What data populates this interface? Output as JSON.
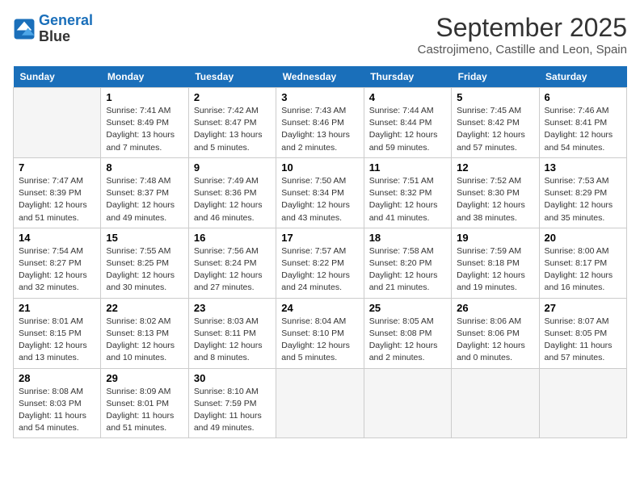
{
  "header": {
    "logo_line1": "General",
    "logo_line2": "Blue",
    "month": "September 2025",
    "location": "Castrojimeno, Castille and Leon, Spain"
  },
  "days_of_week": [
    "Sunday",
    "Monday",
    "Tuesday",
    "Wednesday",
    "Thursday",
    "Friday",
    "Saturday"
  ],
  "weeks": [
    [
      {
        "day": "",
        "empty": true
      },
      {
        "day": "1",
        "sunrise": "Sunrise: 7:41 AM",
        "sunset": "Sunset: 8:49 PM",
        "daylight": "Daylight: 13 hours and 7 minutes."
      },
      {
        "day": "2",
        "sunrise": "Sunrise: 7:42 AM",
        "sunset": "Sunset: 8:47 PM",
        "daylight": "Daylight: 13 hours and 5 minutes."
      },
      {
        "day": "3",
        "sunrise": "Sunrise: 7:43 AM",
        "sunset": "Sunset: 8:46 PM",
        "daylight": "Daylight: 13 hours and 2 minutes."
      },
      {
        "day": "4",
        "sunrise": "Sunrise: 7:44 AM",
        "sunset": "Sunset: 8:44 PM",
        "daylight": "Daylight: 12 hours and 59 minutes."
      },
      {
        "day": "5",
        "sunrise": "Sunrise: 7:45 AM",
        "sunset": "Sunset: 8:42 PM",
        "daylight": "Daylight: 12 hours and 57 minutes."
      },
      {
        "day": "6",
        "sunrise": "Sunrise: 7:46 AM",
        "sunset": "Sunset: 8:41 PM",
        "daylight": "Daylight: 12 hours and 54 minutes."
      }
    ],
    [
      {
        "day": "7",
        "sunrise": "Sunrise: 7:47 AM",
        "sunset": "Sunset: 8:39 PM",
        "daylight": "Daylight: 12 hours and 51 minutes."
      },
      {
        "day": "8",
        "sunrise": "Sunrise: 7:48 AM",
        "sunset": "Sunset: 8:37 PM",
        "daylight": "Daylight: 12 hours and 49 minutes."
      },
      {
        "day": "9",
        "sunrise": "Sunrise: 7:49 AM",
        "sunset": "Sunset: 8:36 PM",
        "daylight": "Daylight: 12 hours and 46 minutes."
      },
      {
        "day": "10",
        "sunrise": "Sunrise: 7:50 AM",
        "sunset": "Sunset: 8:34 PM",
        "daylight": "Daylight: 12 hours and 43 minutes."
      },
      {
        "day": "11",
        "sunrise": "Sunrise: 7:51 AM",
        "sunset": "Sunset: 8:32 PM",
        "daylight": "Daylight: 12 hours and 41 minutes."
      },
      {
        "day": "12",
        "sunrise": "Sunrise: 7:52 AM",
        "sunset": "Sunset: 8:30 PM",
        "daylight": "Daylight: 12 hours and 38 minutes."
      },
      {
        "day": "13",
        "sunrise": "Sunrise: 7:53 AM",
        "sunset": "Sunset: 8:29 PM",
        "daylight": "Daylight: 12 hours and 35 minutes."
      }
    ],
    [
      {
        "day": "14",
        "sunrise": "Sunrise: 7:54 AM",
        "sunset": "Sunset: 8:27 PM",
        "daylight": "Daylight: 12 hours and 32 minutes."
      },
      {
        "day": "15",
        "sunrise": "Sunrise: 7:55 AM",
        "sunset": "Sunset: 8:25 PM",
        "daylight": "Daylight: 12 hours and 30 minutes."
      },
      {
        "day": "16",
        "sunrise": "Sunrise: 7:56 AM",
        "sunset": "Sunset: 8:24 PM",
        "daylight": "Daylight: 12 hours and 27 minutes."
      },
      {
        "day": "17",
        "sunrise": "Sunrise: 7:57 AM",
        "sunset": "Sunset: 8:22 PM",
        "daylight": "Daylight: 12 hours and 24 minutes."
      },
      {
        "day": "18",
        "sunrise": "Sunrise: 7:58 AM",
        "sunset": "Sunset: 8:20 PM",
        "daylight": "Daylight: 12 hours and 21 minutes."
      },
      {
        "day": "19",
        "sunrise": "Sunrise: 7:59 AM",
        "sunset": "Sunset: 8:18 PM",
        "daylight": "Daylight: 12 hours and 19 minutes."
      },
      {
        "day": "20",
        "sunrise": "Sunrise: 8:00 AM",
        "sunset": "Sunset: 8:17 PM",
        "daylight": "Daylight: 12 hours and 16 minutes."
      }
    ],
    [
      {
        "day": "21",
        "sunrise": "Sunrise: 8:01 AM",
        "sunset": "Sunset: 8:15 PM",
        "daylight": "Daylight: 12 hours and 13 minutes."
      },
      {
        "day": "22",
        "sunrise": "Sunrise: 8:02 AM",
        "sunset": "Sunset: 8:13 PM",
        "daylight": "Daylight: 12 hours and 10 minutes."
      },
      {
        "day": "23",
        "sunrise": "Sunrise: 8:03 AM",
        "sunset": "Sunset: 8:11 PM",
        "daylight": "Daylight: 12 hours and 8 minutes."
      },
      {
        "day": "24",
        "sunrise": "Sunrise: 8:04 AM",
        "sunset": "Sunset: 8:10 PM",
        "daylight": "Daylight: 12 hours and 5 minutes."
      },
      {
        "day": "25",
        "sunrise": "Sunrise: 8:05 AM",
        "sunset": "Sunset: 8:08 PM",
        "daylight": "Daylight: 12 hours and 2 minutes."
      },
      {
        "day": "26",
        "sunrise": "Sunrise: 8:06 AM",
        "sunset": "Sunset: 8:06 PM",
        "daylight": "Daylight: 12 hours and 0 minutes."
      },
      {
        "day": "27",
        "sunrise": "Sunrise: 8:07 AM",
        "sunset": "Sunset: 8:05 PM",
        "daylight": "Daylight: 11 hours and 57 minutes."
      }
    ],
    [
      {
        "day": "28",
        "sunrise": "Sunrise: 8:08 AM",
        "sunset": "Sunset: 8:03 PM",
        "daylight": "Daylight: 11 hours and 54 minutes."
      },
      {
        "day": "29",
        "sunrise": "Sunrise: 8:09 AM",
        "sunset": "Sunset: 8:01 PM",
        "daylight": "Daylight: 11 hours and 51 minutes."
      },
      {
        "day": "30",
        "sunrise": "Sunrise: 8:10 AM",
        "sunset": "Sunset: 7:59 PM",
        "daylight": "Daylight: 11 hours and 49 minutes."
      },
      {
        "day": "",
        "empty": true
      },
      {
        "day": "",
        "empty": true
      },
      {
        "day": "",
        "empty": true
      },
      {
        "day": "",
        "empty": true
      }
    ]
  ]
}
